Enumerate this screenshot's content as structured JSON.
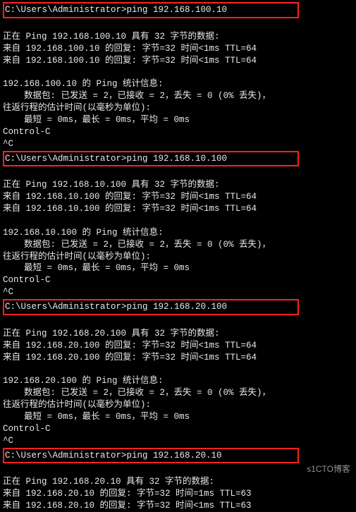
{
  "terminal": {
    "lines": [
      {
        "cls": "hilite",
        "text": "C:\\Users\\Administrator>ping 192.168.100.10"
      },
      {
        "cls": "blank",
        "text": " "
      },
      {
        "cls": "line",
        "text": "正在 Ping 192.168.100.10 具有 32 字节的数据:"
      },
      {
        "cls": "line",
        "text": "来自 192.168.100.10 的回复: 字节=32 时间<1ms TTL=64"
      },
      {
        "cls": "line",
        "text": "来自 192.168.100.10 的回复: 字节=32 时间<1ms TTL=64"
      },
      {
        "cls": "blank",
        "text": " "
      },
      {
        "cls": "line",
        "text": "192.168.100.10 的 Ping 统计信息:"
      },
      {
        "cls": "line",
        "text": "    数据包: 已发送 = 2，已接收 = 2，丢失 = 0 (0% 丢失)，"
      },
      {
        "cls": "line",
        "text": "往返行程的估计时间(以毫秒为单位):"
      },
      {
        "cls": "line",
        "text": "    最短 = 0ms，最长 = 0ms，平均 = 0ms"
      },
      {
        "cls": "line",
        "text": "Control-C"
      },
      {
        "cls": "line",
        "text": "^C"
      },
      {
        "cls": "hilite",
        "text": "C:\\Users\\Administrator>ping 192.168.10.100"
      },
      {
        "cls": "blank",
        "text": " "
      },
      {
        "cls": "line",
        "text": "正在 Ping 192.168.10.100 具有 32 字节的数据:"
      },
      {
        "cls": "line",
        "text": "来自 192.168.10.100 的回复: 字节=32 时间<1ms TTL=64"
      },
      {
        "cls": "line",
        "text": "来自 192.168.10.100 的回复: 字节=32 时间<1ms TTL=64"
      },
      {
        "cls": "blank",
        "text": " "
      },
      {
        "cls": "line",
        "text": "192.168.10.100 的 Ping 统计信息:"
      },
      {
        "cls": "line",
        "text": "    数据包: 已发送 = 2，已接收 = 2，丢失 = 0 (0% 丢失)，"
      },
      {
        "cls": "line",
        "text": "往返行程的估计时间(以毫秒为单位):"
      },
      {
        "cls": "line",
        "text": "    最短 = 0ms，最长 = 0ms，平均 = 0ms"
      },
      {
        "cls": "line",
        "text": "Control-C"
      },
      {
        "cls": "line",
        "text": "^C"
      },
      {
        "cls": "hilite",
        "text": "C:\\Users\\Administrator>ping 192.168.20.100"
      },
      {
        "cls": "blank",
        "text": " "
      },
      {
        "cls": "line",
        "text": "正在 Ping 192.168.20.100 具有 32 字节的数据:"
      },
      {
        "cls": "line",
        "text": "来自 192.168.20.100 的回复: 字节=32 时间<1ms TTL=64"
      },
      {
        "cls": "line",
        "text": "来自 192.168.20.100 的回复: 字节=32 时间<1ms TTL=64"
      },
      {
        "cls": "blank",
        "text": " "
      },
      {
        "cls": "line",
        "text": "192.168.20.100 的 Ping 统计信息:"
      },
      {
        "cls": "line",
        "text": "    数据包: 已发送 = 2，已接收 = 2，丢失 = 0 (0% 丢失)，"
      },
      {
        "cls": "line",
        "text": "往返行程的估计时间(以毫秒为单位):"
      },
      {
        "cls": "line",
        "text": "    最短 = 0ms，最长 = 0ms，平均 = 0ms"
      },
      {
        "cls": "line",
        "text": "Control-C"
      },
      {
        "cls": "line",
        "text": "^C"
      },
      {
        "cls": "hilite",
        "text": "C:\\Users\\Administrator>ping 192.168.20.10"
      },
      {
        "cls": "blank",
        "text": " "
      },
      {
        "cls": "line",
        "text": "正在 Ping 192.168.20.10 具有 32 字节的数据:"
      },
      {
        "cls": "line",
        "text": "来自 192.168.20.10 的回复: 字节=32 时间=1ms TTL=63"
      },
      {
        "cls": "line",
        "text": "来自 192.168.20.10 的回复: 字节=32 时间<1ms TTL=63"
      }
    ]
  },
  "watermark": "s1CTO博客"
}
